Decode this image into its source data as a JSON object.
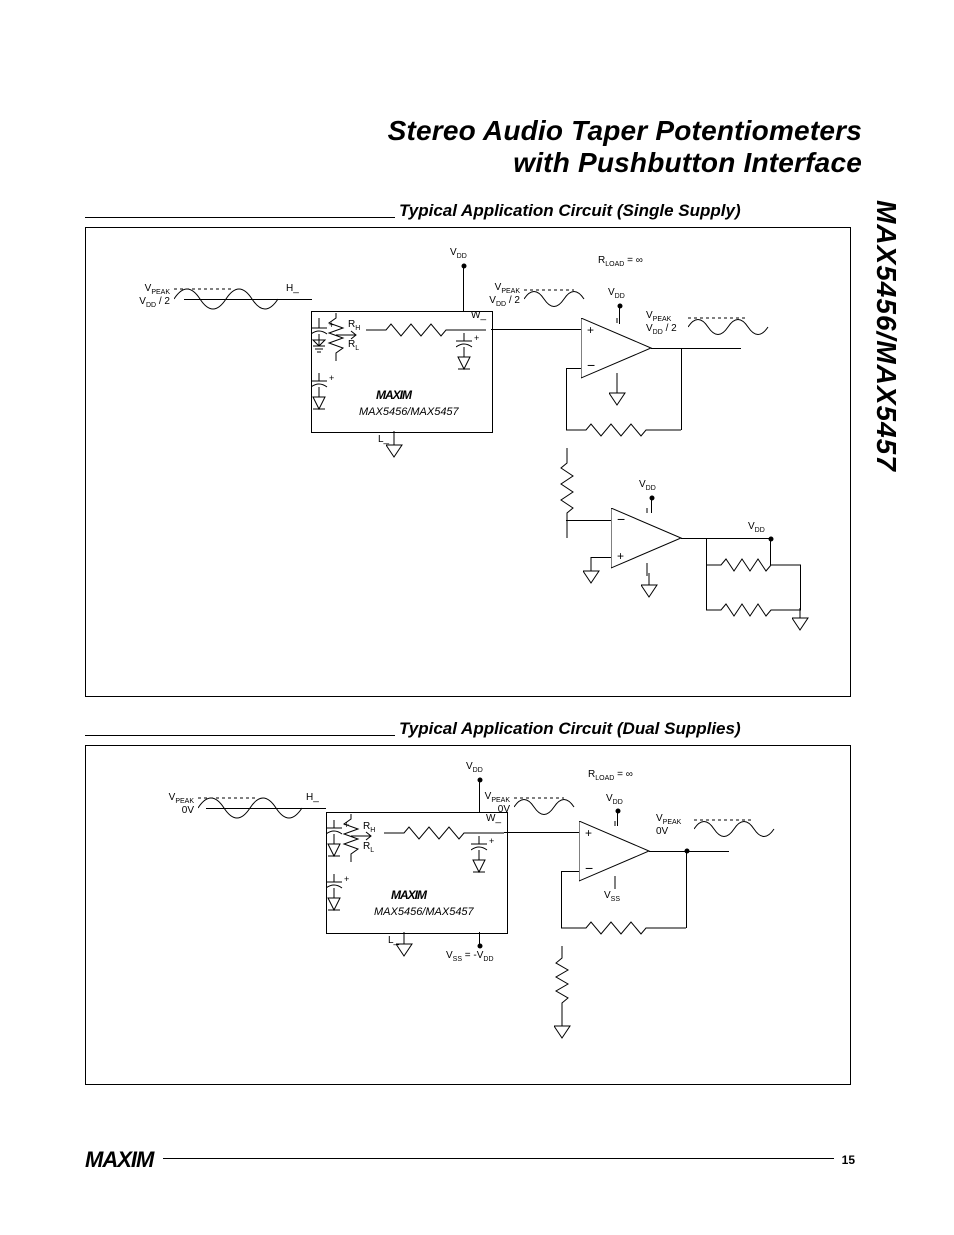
{
  "title_line1": "Stereo Audio Taper Potentiometers",
  "title_line2": "with Pushbutton Interface",
  "side_code": "MAX5456/MAX5457",
  "section1_heading": "Typical Application Circuit (Single Supply)",
  "section2_heading": "Typical Application Circuit (Dual Supplies)",
  "page_number": "15",
  "footer_logo": "MAXIM",
  "diagram_common": {
    "vdd": "V",
    "vdd_sub": "DD",
    "vss": "V",
    "vss_sub": "SS",
    "vpeak": "V",
    "vpeak_sub": "PEAK",
    "rload": "R",
    "rload_sub": "LOAD",
    "rload_eq": " = ∞",
    "h_pin": "H_",
    "w_pin": "W_",
    "l_pin": "L_",
    "rh": "R",
    "rh_sub": "H",
    "rl": "R",
    "rl_sub": "L",
    "chip_logo": "MAXIM",
    "chip_name": "MAX5456/MAX5457"
  },
  "diagram1": {
    "vref_line": "V",
    "vref_sub": "DD",
    "vref_div": " / 2"
  },
  "diagram2": {
    "vref_line": "0V",
    "vss_eq": " = -V",
    "vss_eq_sub": "DD"
  }
}
